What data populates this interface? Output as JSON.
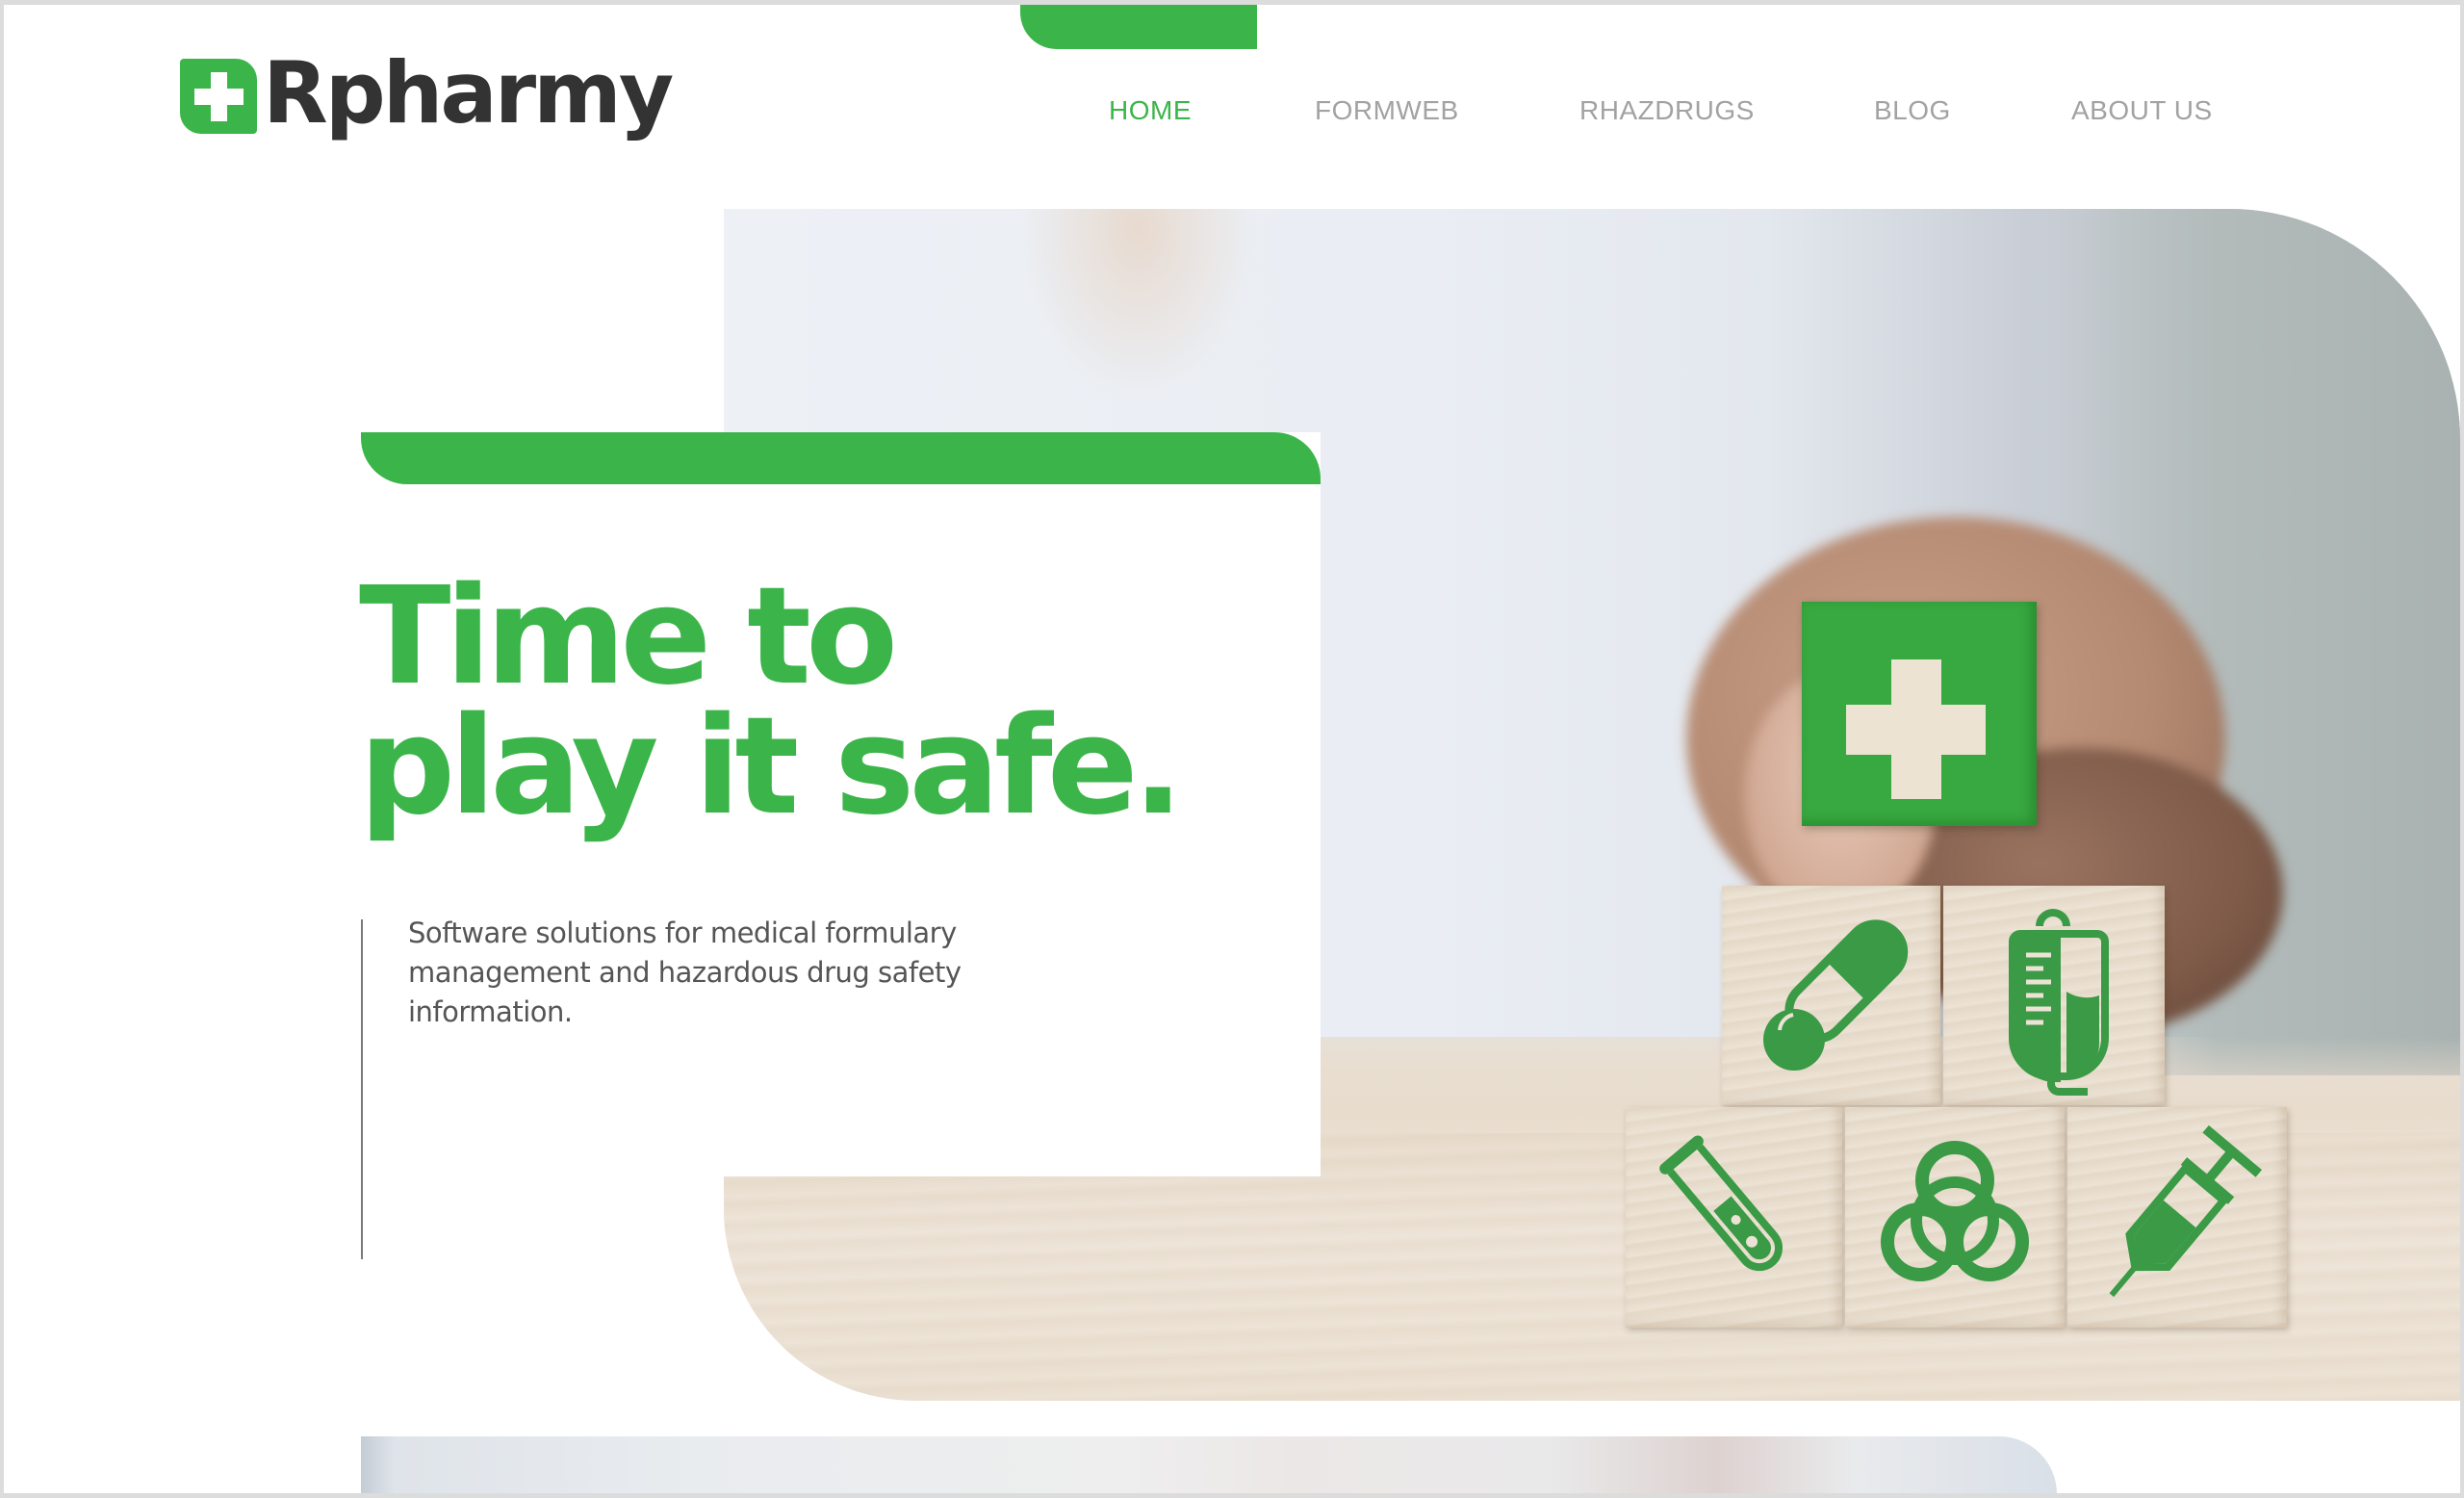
{
  "brand": {
    "name": "Rpharmy",
    "logo_icon": "medical-cross-icon",
    "accent_color": "#3bb54a",
    "text_color": "#333333"
  },
  "nav": {
    "items": [
      {
        "label": "HOME",
        "active": true
      },
      {
        "label": "FORMWEB",
        "active": false
      },
      {
        "label": "RHAZDRUGS",
        "active": false
      },
      {
        "label": "BLOG",
        "active": false
      },
      {
        "label": "ABOUT US",
        "active": false
      }
    ],
    "active_color": "#3bb54a",
    "inactive_color": "#a2a2a2"
  },
  "hero": {
    "headline_line1": "Time to",
    "headline_line2": "play it safe.",
    "subtitle": "Software solutions for medical formulary management and hazardous drug safety information.",
    "image_alt": "Hand placing green medical-cross wooden block on a stack of wooden blocks with healthcare icons",
    "blocks": [
      {
        "icon": "medical-cross-icon",
        "row": "top",
        "color": "green"
      },
      {
        "icon": "pills-capsule-icon",
        "row": "middle"
      },
      {
        "icon": "iv-bag-icon",
        "row": "middle"
      },
      {
        "icon": "test-tube-icon",
        "row": "bottom"
      },
      {
        "icon": "biohazard-icon",
        "row": "bottom"
      },
      {
        "icon": "syringe-icon",
        "row": "bottom"
      }
    ]
  }
}
